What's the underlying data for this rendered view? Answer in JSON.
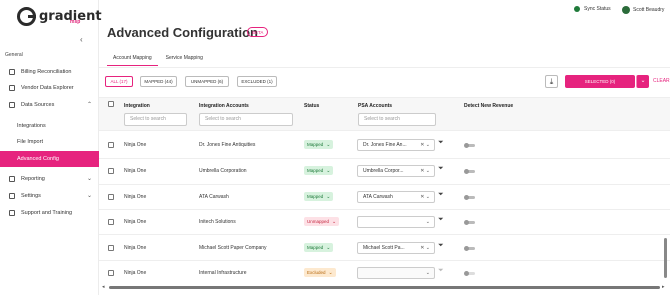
{
  "brand": {
    "name": "gradient",
    "sub": "msp"
  },
  "sidebar": {
    "section": "General",
    "items": [
      {
        "label": "Billing Reconciliation"
      },
      {
        "label": "Vendor Data Explorer"
      },
      {
        "label": "Data Sources"
      },
      {
        "label": "Integrations"
      },
      {
        "label": "File Import"
      },
      {
        "label": "Advanced Config"
      },
      {
        "label": "Reporting"
      },
      {
        "label": "Settings"
      },
      {
        "label": "Support and Training"
      }
    ]
  },
  "topbar": {
    "sync_status": "Sync Status",
    "user": "Scott Beaudry"
  },
  "page": {
    "title": "Advanced Configuration",
    "badge": "BETA"
  },
  "tabs": [
    "Account Mapping",
    "Service Mapping"
  ],
  "filters": [
    "ALL (17)",
    "MAPPED (44)",
    "UNMAPPED (6)",
    "EXCLUDED (1)"
  ],
  "actions": {
    "selected": "SELECTED (0)",
    "clear": "CLEAR"
  },
  "columns": {
    "integration": "Integration",
    "accounts": "Integration Accounts",
    "status": "Status",
    "psa": "PSA Accounts",
    "revenue": "Detect New Revenue"
  },
  "search_placeholder": "Select to search",
  "rows": [
    {
      "integration": "Ninja One",
      "account": "Dr. Jones Fine Antiquities",
      "status": "Mapped",
      "psa": "Dr. Jones Fine An..."
    },
    {
      "integration": "Ninja One",
      "account": "Umbrella Corporation",
      "status": "Mapped",
      "psa": "Umbrella Corpor..."
    },
    {
      "integration": "Ninja One",
      "account": "ATA Carwash",
      "status": "Mapped",
      "psa": "ATA Carwash"
    },
    {
      "integration": "Ninja One",
      "account": "Initech Solutions",
      "status": "Unmapped",
      "psa": ""
    },
    {
      "integration": "Ninja One",
      "account": "Michael Scott Paper Company",
      "status": "Mapped",
      "psa": "Michael Scott Pa..."
    },
    {
      "integration": "Ninja One",
      "account": "Internal Infrastructure",
      "status": "Excluded",
      "psa": ""
    }
  ],
  "colors": {
    "accent": "#e6237e",
    "mapped": "#1e7a3a",
    "unmapped": "#c62842",
    "excluded": "#b76a10"
  }
}
